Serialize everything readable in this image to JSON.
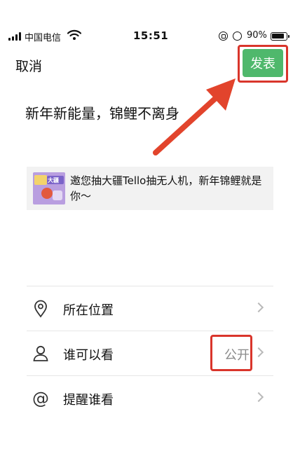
{
  "status_bar": {
    "carrier": "中国电信",
    "time": "15:51",
    "battery_percent": "90%",
    "battery_level": 0.9,
    "icons": [
      "signal-icon",
      "wifi-icon",
      "orientation-lock-icon",
      "alarm-icon",
      "battery-icon"
    ]
  },
  "nav": {
    "cancel_label": "取消",
    "publish_label": "发表"
  },
  "post": {
    "text": "新年新能量，锦鲤不离身"
  },
  "link_card": {
    "title": "邀您抽大疆Tello抽无人机，新年锦鲤就是你～",
    "thumbnail_text": "大疆"
  },
  "options": [
    {
      "label": "所在位置",
      "value": "",
      "icon": "location-pin-icon"
    },
    {
      "label": "谁可以看",
      "value": "公开",
      "icon": "person-icon"
    },
    {
      "label": "提醒谁看",
      "value": "",
      "icon": "at-icon"
    }
  ],
  "colors": {
    "publish_button": "#4fb86c",
    "annotation_red": "#d9352b",
    "card_background": "#f2f2f2"
  }
}
